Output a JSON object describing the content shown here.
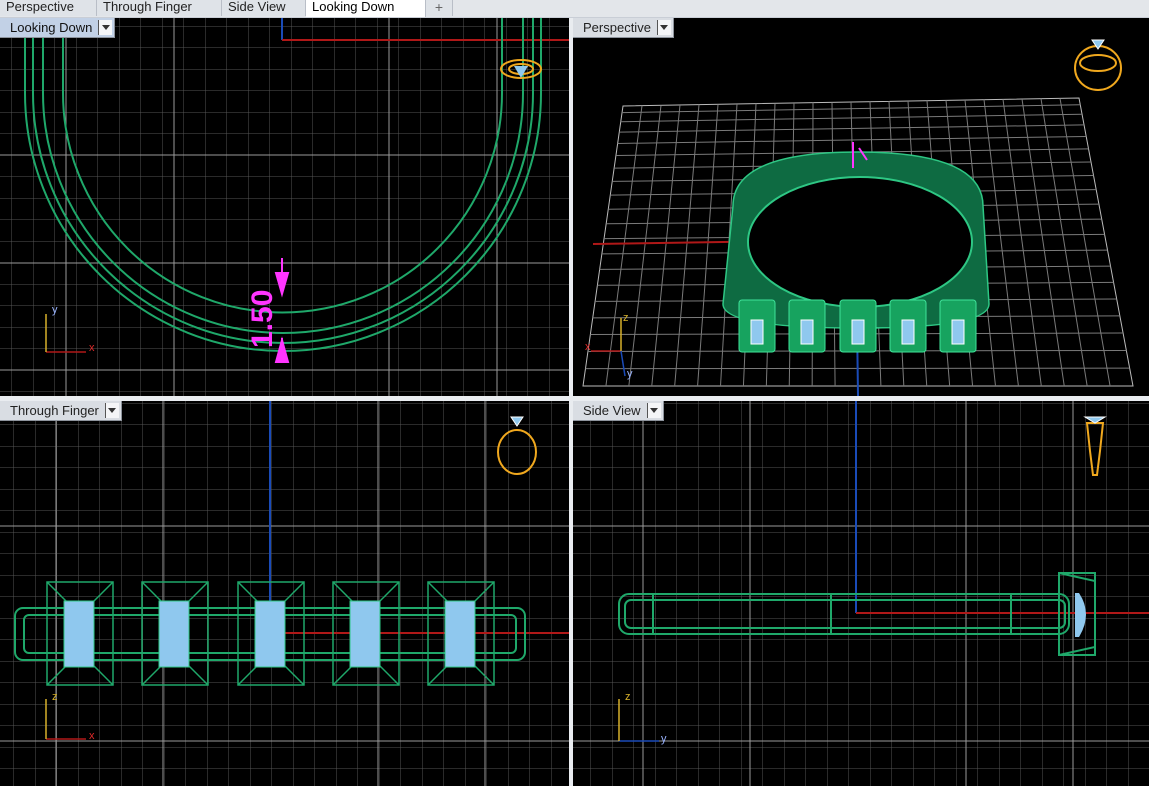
{
  "tabs": [
    {
      "label": "Perspective",
      "active": false
    },
    {
      "label": "Through Finger",
      "active": false
    },
    {
      "label": "Side View",
      "active": false
    },
    {
      "label": "Looking Down",
      "active": true
    }
  ],
  "tab_add_icon": "plus-icon",
  "viewports": {
    "looking_down": {
      "label": "Looking Down",
      "active": true,
      "dimension": "1.50",
      "axes": [
        "y",
        "x"
      ]
    },
    "perspective": {
      "label": "Perspective",
      "active": false,
      "axes": [
        "z",
        "x",
        "y"
      ]
    },
    "through_finger": {
      "label": "Through Finger",
      "active": false,
      "axes": [
        "z",
        "x"
      ]
    },
    "side_view": {
      "label": "Side View",
      "active": false,
      "axes": [
        "z",
        "y"
      ]
    }
  },
  "colors": {
    "background": "#000000",
    "grid": "#6e6e6e",
    "model_wire": "#1fa86a",
    "stone": "#8fc8ee",
    "dimension": "#ff35ff",
    "axis_x": "#b01818",
    "axis_y": "#1a4bb8",
    "widget": "#f0a81e"
  }
}
